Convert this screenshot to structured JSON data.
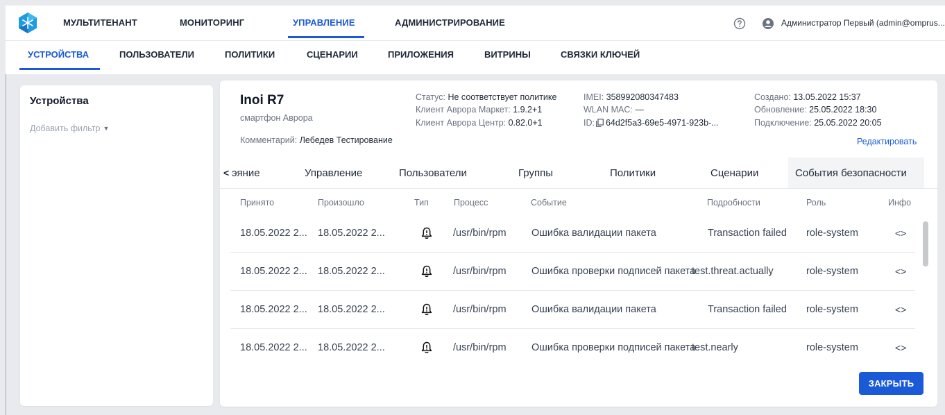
{
  "topnav": {
    "items": [
      "МУЛЬТИТЕНАНТ",
      "МОНИТОРИНГ",
      "УПРАВЛЕНИЕ",
      "АДМИНИСТРИРОВАНИЕ"
    ],
    "active": "УПРАВЛЕНИЕ",
    "user": "Администратор Первый (admin@omprus..."
  },
  "subnav": {
    "items": [
      "УСТРОЙСТВА",
      "ПОЛЬЗОВАТЕЛИ",
      "ПОЛИТИКИ",
      "СЦЕНАРИИ",
      "ПРИЛОЖЕНИЯ",
      "ВИТРИНЫ",
      "СВЯЗКИ КЛЮЧЕЙ"
    ],
    "active": "УСТРОЙСТВА"
  },
  "left": {
    "title": "Устройства",
    "add_filter": "Добавить фильтр"
  },
  "device": {
    "name": "Inoi R7",
    "type": "смартфон Аврора",
    "comment_label": "Комментарий:",
    "comment": "Лебедев Тестирование",
    "status_label": "Статус:",
    "status": "Не соответствует политике",
    "market_label": "Клиент Аврора Маркет:",
    "market": "1.9.2+1",
    "center_label": "Клиент Аврора Центр:",
    "center": "0.82.0+1",
    "imei_label": "IMEI:",
    "imei": "358992080347483",
    "wlan_label": "WLAN MAC:",
    "wlan": "—",
    "id_label": "ID:",
    "id": "64d2f5a3-69e5-4971-923b-...",
    "created_label": "Создано:",
    "created": "13.05.2022 15:37",
    "updated_label": "Обновление:",
    "updated": "25.05.2022 18:30",
    "connected_label": "Подключение:",
    "connected": "25.05.2022 20:05",
    "edit": "Редактировать"
  },
  "tabs": {
    "scroll_glyph": "<",
    "items": [
      "эяние",
      "Управление",
      "Пользователи",
      "Группы",
      "Политики",
      "Сценарии",
      "События безопасности"
    ],
    "active": "События безопасности"
  },
  "table": {
    "headers": [
      "Принято",
      "Произошло",
      "Тип",
      "Процесс",
      "Событие",
      "Подробности",
      "Роль",
      "Инфо"
    ],
    "rows": [
      {
        "received": "18.05.2022 2...",
        "occurred": "18.05.2022 2...",
        "type_icon": "bell-alert-icon",
        "process": "/usr/bin/rpm",
        "event": "Ошибка валидации пакета",
        "details": "Transaction failed",
        "role": "role-system",
        "info": "<>"
      },
      {
        "received": "18.05.2022 2...",
        "occurred": "18.05.2022 2...",
        "type_icon": "bell-alert-icon",
        "process": "/usr/bin/rpm",
        "event": "Ошибка проверки подписей пакета",
        "details": "test.threat.actually",
        "role": "role-system",
        "info": "<>"
      },
      {
        "received": "18.05.2022 2...",
        "occurred": "18.05.2022 2...",
        "type_icon": "bell-alert-icon",
        "process": "/usr/bin/rpm",
        "event": "Ошибка валидации пакета",
        "details": "Transaction failed",
        "role": "role-system",
        "info": "<>"
      },
      {
        "received": "18.05.2022 2...",
        "occurred": "18.05.2022 2...",
        "type_icon": "bell-alert-icon",
        "process": "/usr/bin/rpm",
        "event": "Ошибка проверки подписей пакета",
        "details": "test.nearly",
        "role": "role-system",
        "info": "<>"
      }
    ]
  },
  "close_button": "ЗАКРЫТЬ",
  "colors": {
    "accent": "#1a5ad6",
    "background": "#e8eaee"
  }
}
